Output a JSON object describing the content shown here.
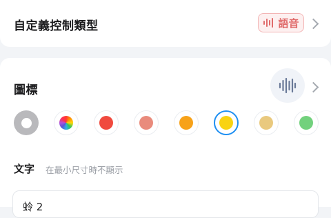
{
  "control_type": {
    "label": "自定義控制類型",
    "value": "語音",
    "value_icon": "voice-wave-icon",
    "accent": "#e06b6b"
  },
  "icon_section": {
    "label": "圖標",
    "preview_icon": "voice-wave-icon",
    "preview_color": "#6a7a98"
  },
  "colors": [
    {
      "name": "default-ring",
      "color": "#b9b9bc"
    },
    {
      "name": "multicolor",
      "color": "rainbow"
    },
    {
      "name": "red",
      "color": "#f04a3e"
    },
    {
      "name": "salmon",
      "color": "#e98b7c"
    },
    {
      "name": "orange",
      "color": "#f7a219"
    },
    {
      "name": "yellow",
      "color": "#f9d312",
      "selected": true
    },
    {
      "name": "khaki",
      "color": "#e9c97e"
    },
    {
      "name": "green",
      "color": "#72d17d"
    }
  ],
  "text_section": {
    "label": "文字",
    "hint": "在最小尺寸時不顯示",
    "value": "蛉 2"
  }
}
